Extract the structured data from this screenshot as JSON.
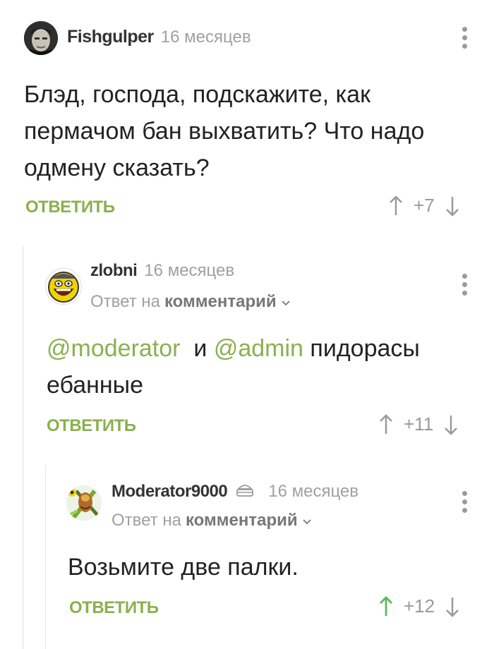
{
  "comments": [
    {
      "author": "Fishgulper",
      "time": "16 месяцев",
      "text": "Блэд, господа, подскажите, как пермачом бан выхватить? Что надо одмену сказать?",
      "reply_label": "ОТВЕТИТЬ",
      "rating": "+7"
    },
    {
      "author": "zlobni",
      "time": "16 месяцев",
      "reply_prefix": "Ответ на",
      "reply_target": "комментарий",
      "mention1": "@moderator",
      "connector": "и",
      "mention2": "@admin",
      "text_rest": "пидорасы ебанные",
      "reply_label": "ОТВЕТИТЬ",
      "rating": "+11"
    },
    {
      "author": "Moderator9000",
      "time": "16 месяцев",
      "reply_prefix": "Ответ на",
      "reply_target": "комментарий",
      "text": "Возьмите две палки.",
      "reply_label": "ОТВЕТИТЬ",
      "rating": "+12"
    }
  ],
  "colors": {
    "accent": "#8ab04f",
    "muted": "#a0a0a0",
    "upvoted": "#5cb85c"
  },
  "icons": [
    "vertical-dots-icon",
    "arrow-up-icon",
    "arrow-down-icon",
    "chevron-down-icon",
    "moderator-badge-icon"
  ]
}
